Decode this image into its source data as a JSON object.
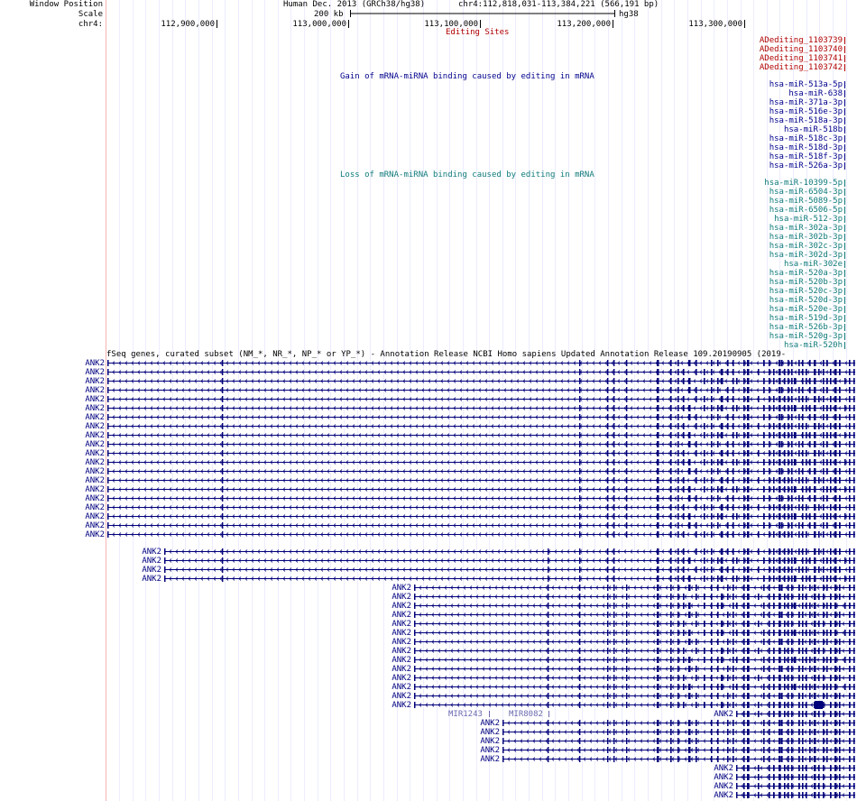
{
  "header": {
    "window_position_label": "Window Position",
    "scale_label": "Scale",
    "chrom_label": "chr4:",
    "assembly": "Human Dec. 2013 (GRCh38/hg38)",
    "position": "chr4:112,818,031-113,384,221 (566,191 bp)",
    "scale_text": "200 kb",
    "db": "hg38",
    "ruler_ticks": [
      "112,900,000",
      "113,000,000",
      "113,100,000",
      "113,200,000",
      "113,300,000"
    ]
  },
  "editing_track": {
    "title": "Editing Sites",
    "items": [
      "ADediting_1103739",
      "ADediting_1103740",
      "ADediting_1103741",
      "ADediting_1103742"
    ]
  },
  "gain_track": {
    "title": "Gain of mRNA-miRNA binding caused by editing in mRNA",
    "items": [
      "hsa-miR-513a-5p",
      "hsa-miR-638",
      "hsa-miR-371a-3p",
      "hsa-miR-516e-3p",
      "hsa-miR-518a-3p",
      "hsa-miR-518b",
      "hsa-miR-518c-3p",
      "hsa-miR-518d-3p",
      "hsa-miR-518f-3p",
      "hsa-miR-526a-3p"
    ]
  },
  "loss_track": {
    "title": "Loss of mRNA-miRNA binding caused by editing in mRNA",
    "items": [
      "hsa-miR-10399-5p",
      "hsa-miR-6504-3p",
      "hsa-miR-5089-5p",
      "hsa-miR-6506-5p",
      "hsa-miR-512-3p",
      "hsa-miR-302a-3p",
      "hsa-miR-302b-3p",
      "hsa-miR-302c-3p",
      "hsa-miR-302d-3p",
      "hsa-miR-302e",
      "hsa-miR-520a-3p",
      "hsa-miR-520b-3p",
      "hsa-miR-520c-3p",
      "hsa-miR-520d-3p",
      "hsa-miR-520e-3p",
      "hsa-miR-519d-3p",
      "hsa-miR-526b-3p",
      "hsa-miR-520g-3p",
      "hsa-miR-520h"
    ]
  },
  "refseq_track": {
    "title": "fSeq genes, curated subset (NM_*, NR_*, NP_* or YP_*) - Annotation Release NCBI Homo sapiens Updated Annotation Release 109.20190905 (2019-",
    "gene_name": "ANK2",
    "mir_labels": [
      "MIR1243",
      "MIR8082"
    ],
    "group_a_count": 20,
    "group_b_count": 4,
    "group_c_count": 14,
    "group_d_count": 5,
    "group_e_count": 5
  }
}
